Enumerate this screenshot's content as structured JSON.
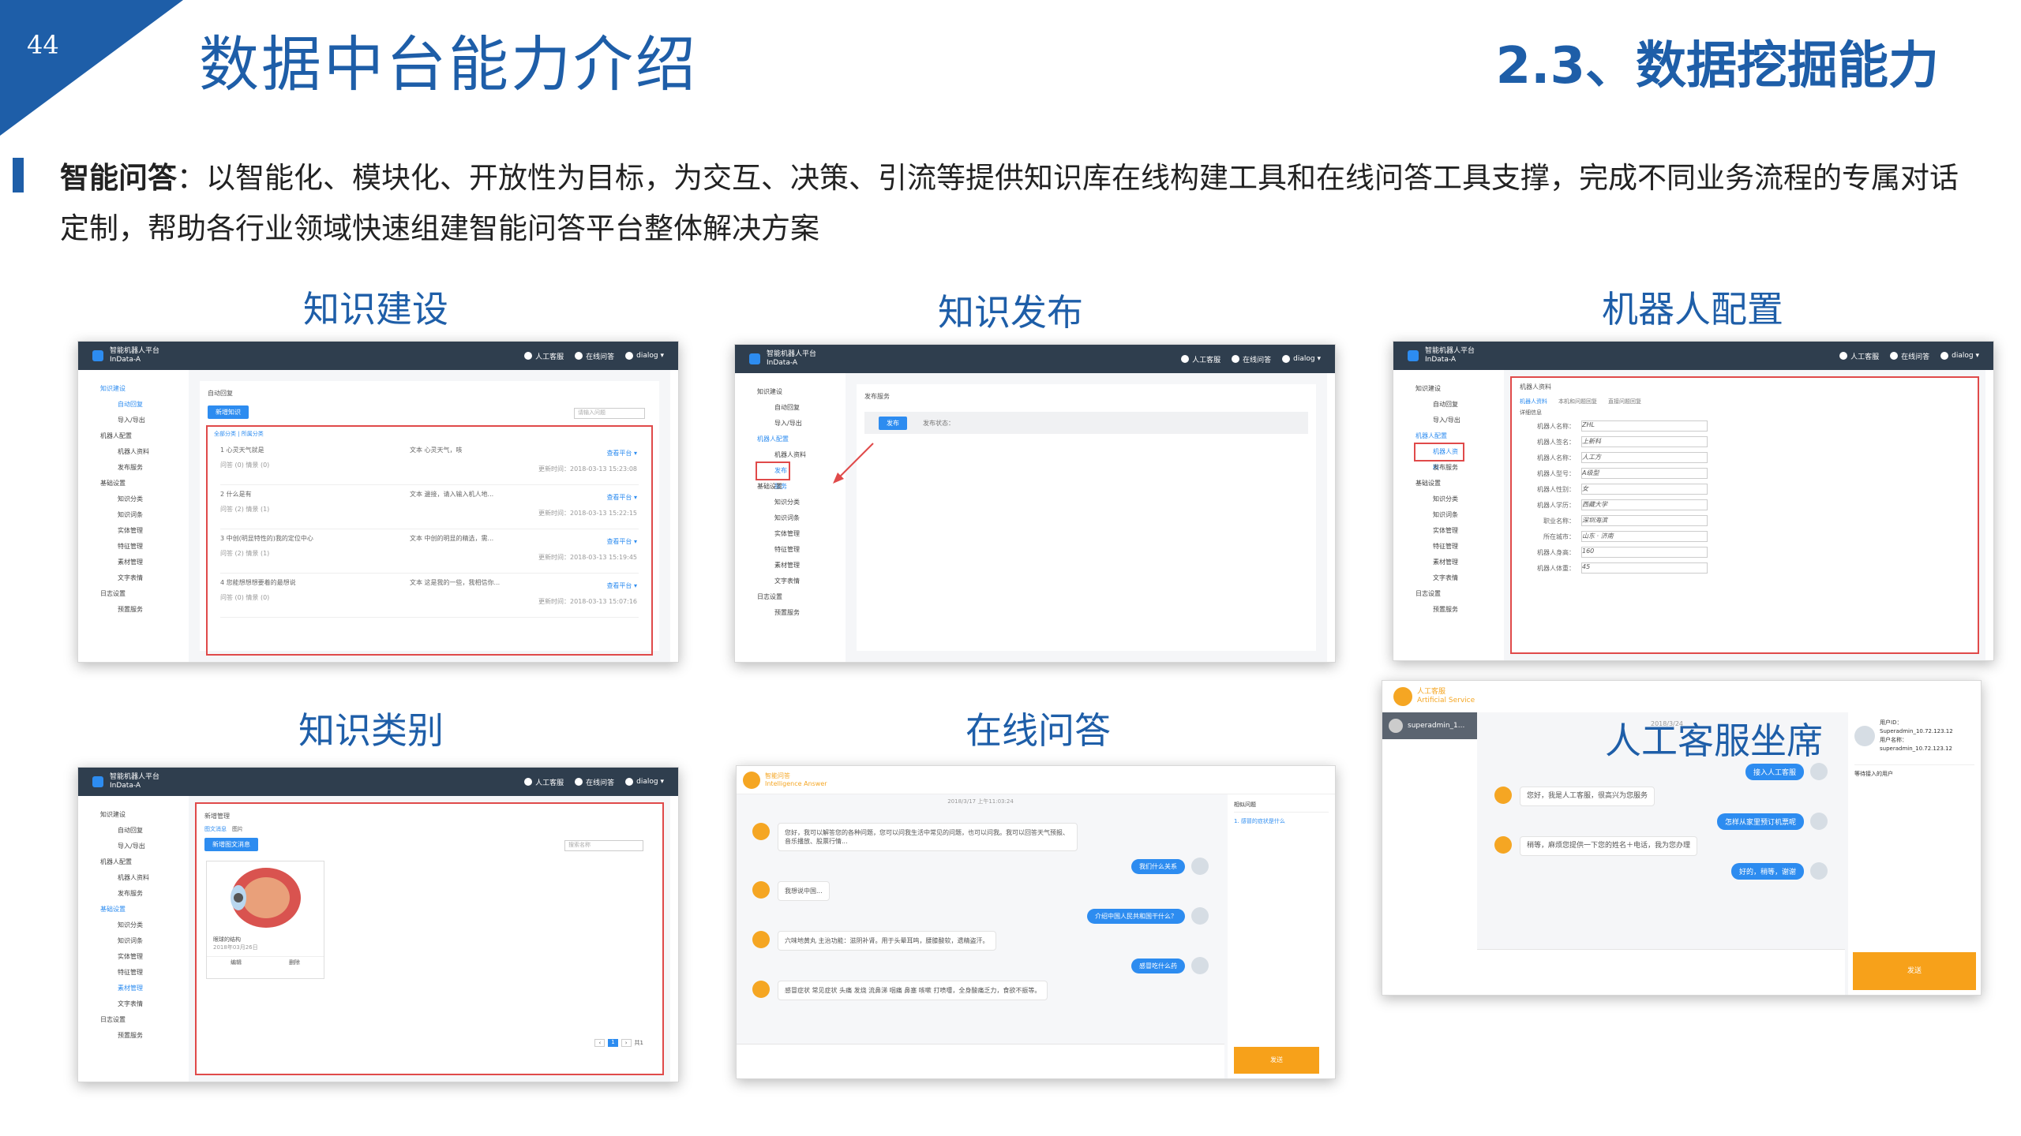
{
  "page": {
    "number": "44",
    "title": "数据中台能力介绍",
    "section": "2.3、数据挖掘能力"
  },
  "intro": {
    "lead": "智能问答",
    "text": "：以智能化、模块化、开放性为目标，为交互、决策、引流等提供知识库在线构建工具和在线问答工具支撑，完成不同业务流程的专属对话定制，帮助各行业领域快速组建智能问答平台整体解决方案"
  },
  "panels": {
    "p1": "知识建设",
    "p2": "知识发布",
    "p3": "机器人配置",
    "p4": "知识类别",
    "p5": "在线问答",
    "p6": "人工客服坐席"
  },
  "app": {
    "name": "智能机器人平台",
    "sub": "InData-A",
    "nav_service": "人工客服",
    "nav_online": "在线问答",
    "user": "dialog ▾",
    "menu": [
      "知识建设",
      "自动回复",
      "导入/导出",
      "机器人配置",
      "机器人资料",
      "发布服务",
      "基础设置",
      "知识分类",
      "知识词条",
      "实体管理",
      "特征管理",
      "素材管理",
      "文字表情",
      "日志设置",
      "预置服务"
    ]
  },
  "s1": {
    "heading": "自动回复",
    "new": "新增知识",
    "search": "请输入问题",
    "tabs": "全部分类 | 所属分类",
    "rows": [
      {
        "q": "1 心灵天气就是",
        "a": "文本 心灵天气，咳",
        "meta": "问答 (0) 情景 (0)",
        "time": "更新时间：2018-03-13 15:23:08",
        "pub": "查看平台 ▾"
      },
      {
        "q": "2 什么是有",
        "a": "文本 邊接，请入输入机人地...",
        "meta": "问答 (2) 情景 (1)",
        "time": "更新时间：2018-03-13 15:22:15",
        "pub": "查看平台 ▾"
      },
      {
        "q": "3 中创(明显特性的)我的定位中心",
        "a": "文本 中创的明显的精选，需...",
        "meta": "问答 (2) 情景 (1)",
        "time": "更新时间：2018-03-13 15:19:45",
        "pub": "查看平台 ▾"
      },
      {
        "q": "4 您能想想想要着的最想说",
        "a": "文本 这是我的一些，我相信你...",
        "meta": "问答 (0) 情景 (0)",
        "time": "更新时间：2018-03-13 15:07:16",
        "pub": "查看平台 ▾"
      }
    ]
  },
  "s2": {
    "heading": "发布服务",
    "btn": "发布",
    "label": "发布状态："
  },
  "s3": {
    "heading": "机器人资料",
    "tabs": [
      "机器人资料",
      "本机和问题回复",
      "直接问题回复"
    ],
    "sub": "详细信息",
    "fields": [
      {
        "k": "机器人名称：",
        "v": "ZHL"
      },
      {
        "k": "机器人签名：",
        "v": "上新科"
      },
      {
        "k": "机器人名称：",
        "v": "人工方"
      },
      {
        "k": "机器人型号：",
        "v": "A级型"
      },
      {
        "k": "机器人性别：",
        "v": "女"
      },
      {
        "k": "机器人学历：",
        "v": "西藏大学"
      },
      {
        "k": "职业名称：",
        "v": "深圳海滨"
      },
      {
        "k": "所在城市：",
        "v": "山东 · 济南"
      },
      {
        "k": "机器人身高：",
        "v": "160"
      },
      {
        "k": "机器人体重：",
        "v": "45"
      }
    ]
  },
  "s4": {
    "heading": "新增管理",
    "tab1": "图文消息",
    "tab2": "图片",
    "new": "新增图文消息",
    "search": "搜索名称",
    "card": "眼球的结构",
    "date": "2018年03月26日",
    "edit": "编辑",
    "del": "删除",
    "pager": "共1"
  },
  "s5": {
    "brand": "智能问答",
    "brand_en": "Intelligence Answer",
    "date": "2018/3/17 上午11:03:24",
    "msgs": [
      {
        "s": "bot",
        "t": "您好，我可以解答您的各种问题，您可以问我生活中常见的问题，也可以问我。我可以回答天气预报、音乐播放、股票行情..."
      },
      {
        "s": "user",
        "t": "我们什么关系"
      },
      {
        "s": "bot",
        "t": "我想说中国..."
      },
      {
        "s": "user",
        "t": "介绍中国人民共和国干什么？"
      },
      {
        "s": "bot",
        "t": "六味地黄丸 主治功能：滋阴补肾。用于头晕耳鸣，腰膝酸软，遗精盗汗。"
      },
      {
        "s": "user",
        "t": "感冒吃什么药"
      },
      {
        "s": "bot",
        "t": "感冒症状 常见症状 头痛 发烧 流鼻涕 咽痛 鼻塞 咳嗽 打喷嚏，全身酸痛乏力，食欲不振等。"
      }
    ],
    "side_title": "相似问题",
    "side_item": "1. 感冒的症状是什么",
    "send": "发送"
  },
  "s6": {
    "brand": "人工客服",
    "brand_en": "Artificial Service",
    "user": "superadmin_1...",
    "date": "2018/3/24",
    "uid": "用户ID：Superadmin_10.72.123.12",
    "uname": "用户名称：superadmin_10.72.123.12",
    "waiting": "等待接入的用户",
    "msgs": [
      {
        "s": "user",
        "t": "接入人工客服"
      },
      {
        "s": "bot",
        "t": "您好，我是人工客服，很高兴为您服务"
      },
      {
        "s": "user",
        "t": "怎样从家里预订机票呢"
      },
      {
        "s": "bot",
        "t": "稍等，麻烦您提供一下您的姓名＋电话，我为您办理"
      },
      {
        "s": "user",
        "t": "好的，稍等，谢谢"
      }
    ],
    "send": "发送"
  }
}
